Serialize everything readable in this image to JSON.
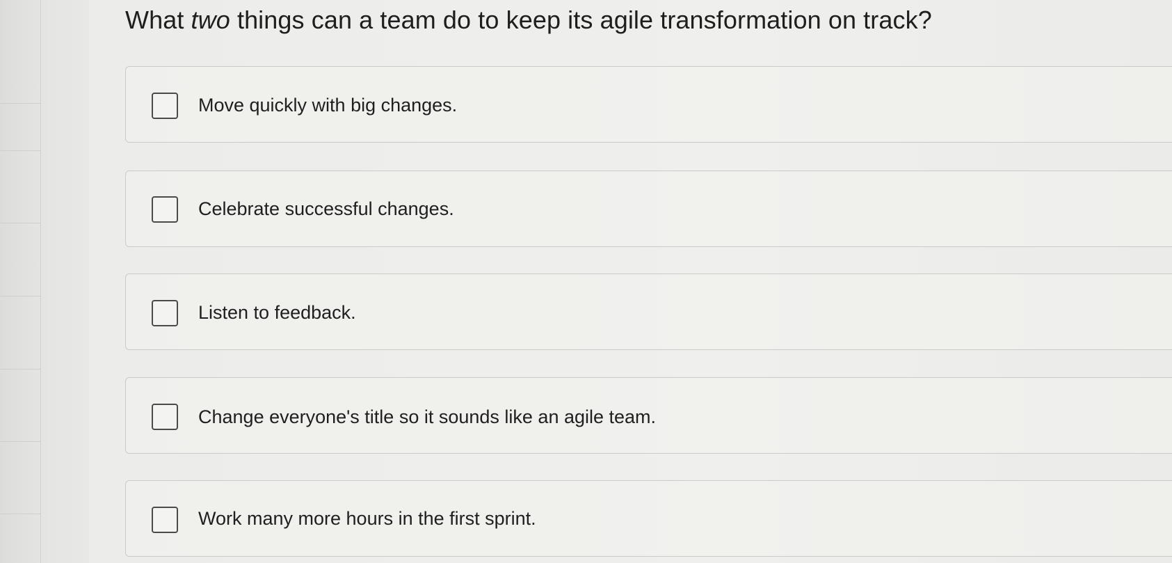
{
  "question": {
    "prefix": "What ",
    "emphasis": "two",
    "suffix": " things can a team do to keep its agile transformation on track?"
  },
  "options": [
    {
      "label": "Move quickly with big changes.",
      "checked": false
    },
    {
      "label": "Celebrate successful changes.",
      "checked": false
    },
    {
      "label": "Listen to feedback.",
      "checked": false
    },
    {
      "label": "Change everyone's title so it sounds like an agile team.",
      "checked": false
    },
    {
      "label": "Work many more hours in the first sprint.",
      "checked": false
    }
  ]
}
